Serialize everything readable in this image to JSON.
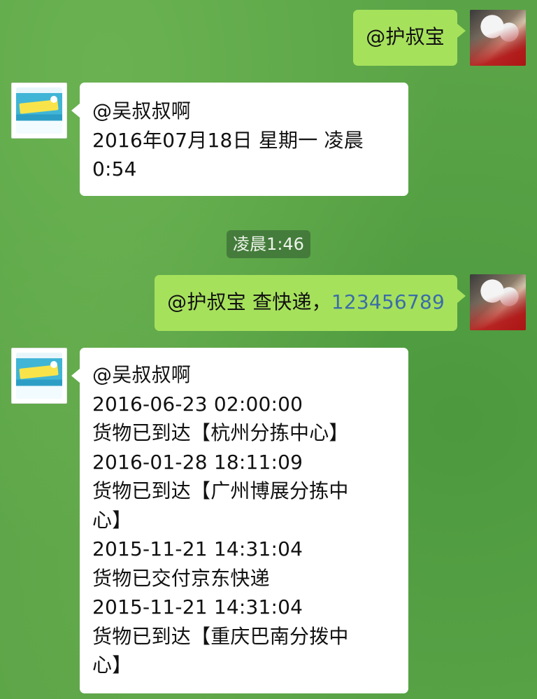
{
  "messages": [
    {
      "side": "out",
      "text": "@护叔宝"
    },
    {
      "side": "in",
      "lines": [
        "@吴叔叔啊",
        "2016年07月18日 星期一 凌晨",
        "0:54"
      ]
    },
    {
      "type": "time",
      "text": "凌晨1:46"
    },
    {
      "side": "out",
      "prefix": "@护叔宝 查快递，",
      "tracking_number": "123456789"
    },
    {
      "side": "in",
      "lines": [
        "@吴叔叔啊",
        "2016-06-23 02:00:00",
        "货物已到达【杭州分拣中心】",
        "2016-01-28 18:11:09",
        "货物已到达【广州博展分拣中",
        "心】",
        "2015-11-21 14:31:04",
        "货物已交付京东快递",
        "2015-11-21 14:31:04",
        "货物已到达【重庆巴南分拨中",
        "心】"
      ]
    }
  ],
  "colors": {
    "chat_background": "#5aa447",
    "outgoing_bubble": "#a6e15c",
    "incoming_bubble": "#ffffff",
    "link_text": "#3a6da8"
  },
  "avatars": {
    "user": "user-photo-avatar",
    "bot": "product-package-avatar"
  }
}
